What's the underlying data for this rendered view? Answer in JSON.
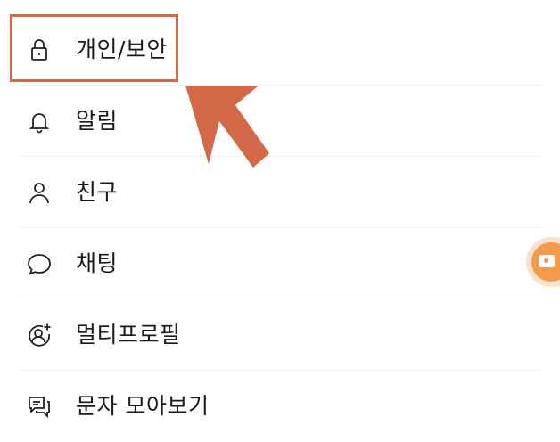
{
  "settings_menu": {
    "items": [
      {
        "label": "개인/보안",
        "icon": "lock-icon"
      },
      {
        "label": "알림",
        "icon": "bell-icon"
      },
      {
        "label": "친구",
        "icon": "person-icon"
      },
      {
        "label": "채팅",
        "icon": "chat-bubble-icon"
      },
      {
        "label": "멀티프로필",
        "icon": "multi-profile-icon"
      },
      {
        "label": "문자 모아보기",
        "icon": "messages-icon"
      }
    ]
  },
  "annotation": {
    "highlight_color": "#d4694a",
    "arrow_color": "#d4694a",
    "highlighted_item": "개인/보안"
  },
  "floating_button": {
    "icon": "wallet-icon",
    "color": "#f39a4c"
  }
}
